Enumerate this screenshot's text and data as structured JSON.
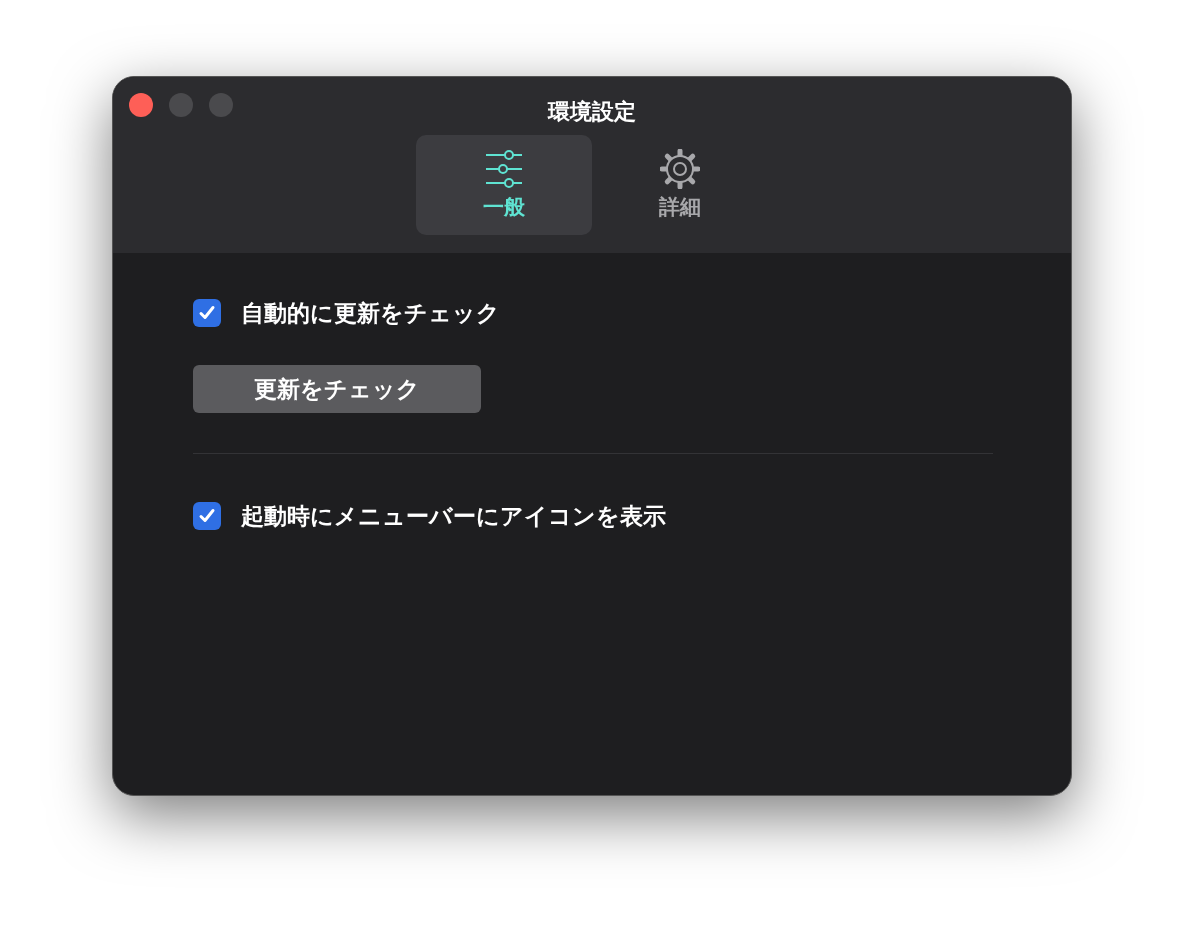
{
  "window": {
    "title": "環境設定"
  },
  "tabs": [
    {
      "label": "一般",
      "selected": true,
      "kind": "sliders"
    },
    {
      "label": "詳細",
      "selected": false,
      "kind": "gear"
    }
  ],
  "settings": [
    {
      "kind": "checkbox",
      "label": "自動的に更新をチェック",
      "checked": true
    },
    {
      "kind": "button",
      "label": "更新をチェック"
    },
    {
      "kind": "divider"
    },
    {
      "kind": "checkbox",
      "label": "起動時にメニューバーにアイコンを表示",
      "checked": true
    }
  ]
}
